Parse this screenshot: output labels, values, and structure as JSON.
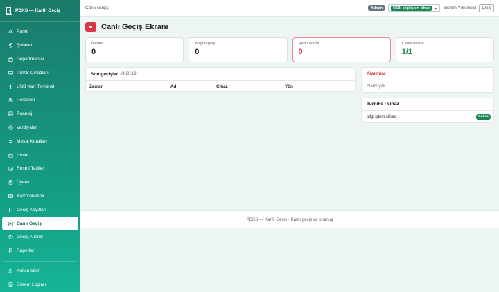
{
  "sidebar": {
    "brand": "PDKS — Kartlı Geçiş",
    "items": [
      {
        "label": "Panel",
        "icon": "gauge-icon"
      },
      {
        "label": "Şubeler",
        "icon": "map-pin-icon"
      },
      {
        "label": "Departmanlar",
        "icon": "building-icon"
      },
      {
        "label": "PDKS Cihazları",
        "icon": "device-icon"
      },
      {
        "label": "USB Kart Terminal",
        "icon": "usb-icon"
      },
      {
        "label": "Personel",
        "icon": "people-icon"
      },
      {
        "label": "Puantaj",
        "icon": "table-icon"
      },
      {
        "label": "Vardiyalar",
        "icon": "clock-icon"
      },
      {
        "label": "Mesai Kuralları",
        "icon": "sliders-icon"
      },
      {
        "label": "İzinler",
        "icon": "calendar-icon"
      },
      {
        "label": "Resmi Tatiller",
        "icon": "calendar-event-icon"
      },
      {
        "label": "Üyeler",
        "icon": "member-icon"
      },
      {
        "label": "Kart Yönetimi",
        "icon": "card-icon"
      },
      {
        "label": "Geçiş Kayıtları",
        "icon": "door-icon"
      },
      {
        "label": "Canlı Geçiş",
        "icon": "broadcast-icon",
        "active": true
      },
      {
        "label": "Geçiş Analizi",
        "icon": "chart-icon"
      },
      {
        "label": "Raporlar",
        "icon": "report-icon"
      }
    ],
    "bottom_items": [
      {
        "label": "Kullanıcılar",
        "icon": "users-icon"
      },
      {
        "label": "Sistem Logları",
        "icon": "log-icon"
      }
    ]
  },
  "topbar": {
    "breadcrumb": "Canlı Geçiş",
    "role_badge": "Admin",
    "usb_status": "USB: bilgi işlem cihazı",
    "user_name": "Sistem Yöneticisi",
    "logout_label": "Çıkış"
  },
  "page": {
    "title": "Canlı Geçiş Ekranı"
  },
  "stats": [
    {
      "label": "İçeride",
      "value": "0",
      "tone": "default"
    },
    {
      "label": "Bugün giriş",
      "value": "0",
      "tone": "default"
    },
    {
      "label": "Red / alarm",
      "value": "0",
      "tone": "red"
    },
    {
      "label": "Cihaz online",
      "value": "1/1",
      "tone": "green"
    }
  ],
  "passes": {
    "title": "Son geçişler",
    "time": "14:20:19",
    "columns": [
      "Zaman",
      "Ad",
      "Cihaz",
      "Yön"
    ]
  },
  "alarms": {
    "title": "Alarmlar",
    "empty_text": "Alarm yok"
  },
  "devices": {
    "title": "Turnike / cihaz",
    "items": [
      {
        "name": "bilgi işlem cihazı",
        "status": "Online"
      }
    ]
  },
  "footer": {
    "text": "PDKS — Kartlı Geçiş · Kartlı geçiş ve puantaj"
  },
  "colors": {
    "sidebar_top": "#1a7a6a",
    "sidebar_bottom": "#16b596",
    "danger": "#dc3545",
    "success": "#198754",
    "background": "#eef6f4"
  }
}
